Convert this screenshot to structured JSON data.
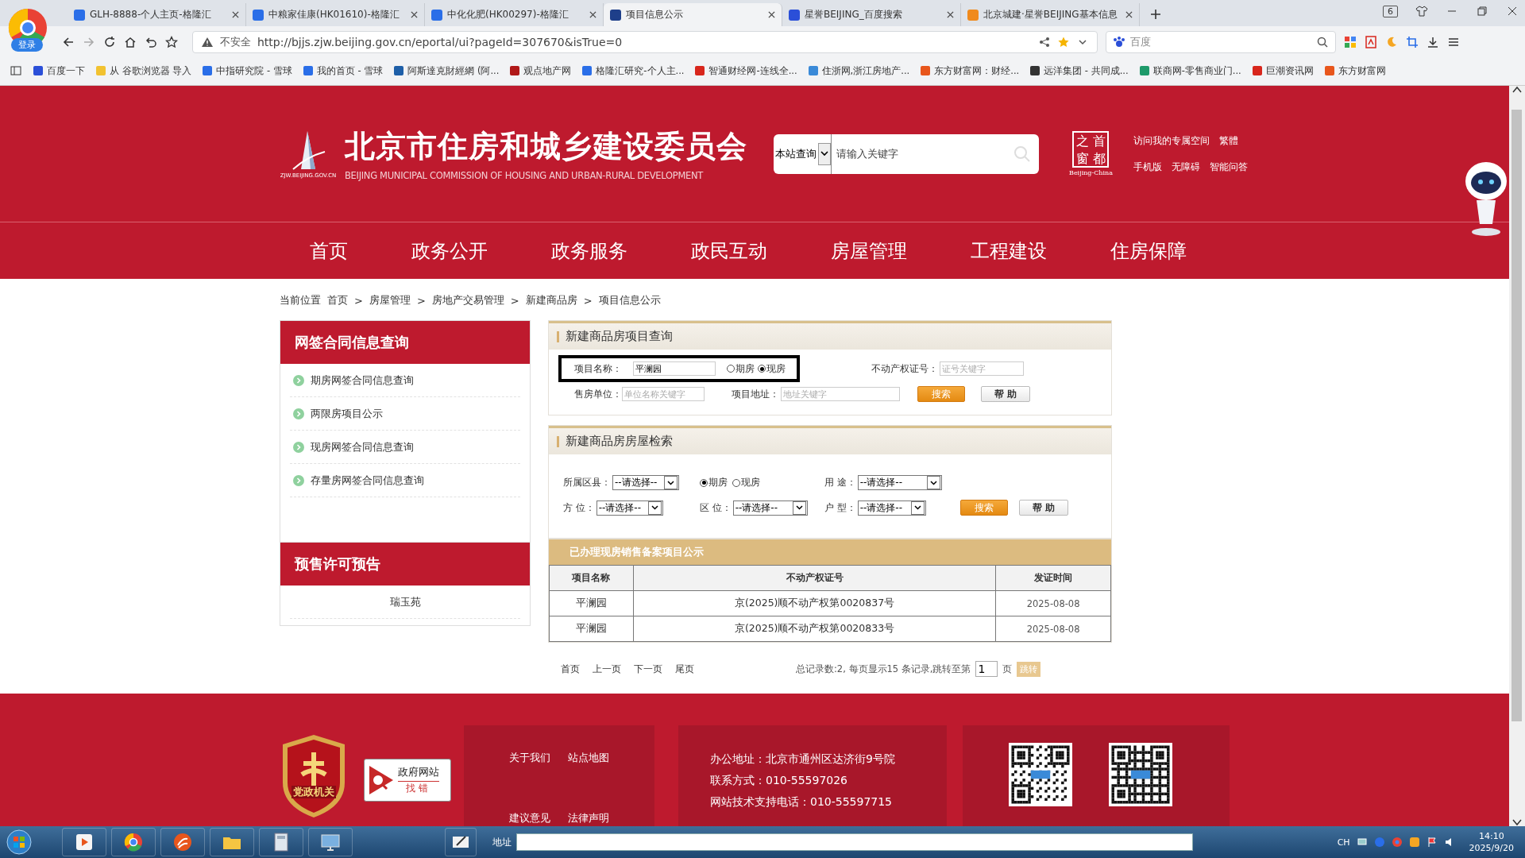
{
  "browser": {
    "login": "登录",
    "tabs": [
      {
        "title": "GLH-8888-个人主页-格隆汇",
        "selected": false,
        "color": "#2a6ee8"
      },
      {
        "title": "中粮家佳康(HK01610)-格隆汇",
        "selected": false,
        "color": "#2a6ee8"
      },
      {
        "title": "中化化肥(HK00297)-格隆汇",
        "selected": false,
        "color": "#2a6ee8"
      },
      {
        "title": "项目信息公示",
        "selected": true,
        "color": "#1e3f8a"
      },
      {
        "title": "星誉BEIJING_百度搜索",
        "selected": false,
        "color": "#2b4fd8"
      },
      {
        "title": "北京城建·星誉BEIJING基本信息",
        "selected": false,
        "color": "#f08a1c"
      }
    ],
    "tab_count": "6",
    "address": {
      "security": "不安全",
      "url": "http://bjjs.zjw.beijing.gov.cn/eportal/ui?pageId=307670&isTrue=0"
    },
    "search": {
      "placeholder": "百度"
    },
    "bookmarks": [
      {
        "label": "百度一下",
        "color": "#2b4fd8"
      },
      {
        "label": "从 谷歌浏览器 导入",
        "color": "#f2c230"
      },
      {
        "label": "中指研究院 - 雪球",
        "color": "#2a6ee8"
      },
      {
        "label": "我的首页 - 雪球",
        "color": "#2a6ee8"
      },
      {
        "label": "阿斯達克財經網 (阿...",
        "color": "#1e5fa8"
      },
      {
        "label": "观点地产网",
        "color": "#b01818"
      },
      {
        "label": "格隆汇研究-个人主...",
        "color": "#2a6ee8"
      },
      {
        "label": "智通财经网-连线全...",
        "color": "#d8261c"
      },
      {
        "label": "住浙网,浙江房地产...",
        "color": "#3a8ad8"
      },
      {
        "label": "东方财富网：财经...",
        "color": "#e8561c"
      },
      {
        "label": "远洋集团 - 共同成...",
        "color": "#333333"
      },
      {
        "label": "联商网-零售商业门...",
        "color": "#1e9a6a"
      },
      {
        "label": "巨潮资讯网",
        "color": "#d8261c"
      },
      {
        "label": "东方财富网",
        "color": "#e8561c"
      }
    ]
  },
  "header": {
    "title": "北京市住房和城乡建设委员会",
    "subtitle": "BEIJING MUNICIPAL COMMISSION OF HOUSING AND URBAN-RURAL DEVELOPMENT",
    "logo_caption": "ZJW.BEIJING.GOV.CN",
    "search": {
      "scope": "本站查询",
      "placeholder": "请输入关键字"
    },
    "badge": {
      "chars": [
        "之",
        "首",
        "窗",
        "都"
      ],
      "caption": "Beijing-China"
    },
    "links": [
      [
        "访问我的专属空间",
        "繁體"
      ],
      [
        "手机版",
        "无障碍",
        "智能问答"
      ]
    ]
  },
  "nav": [
    "首页",
    "政务公开",
    "政务服务",
    "政民互动",
    "房屋管理",
    "工程建设",
    "住房保障"
  ],
  "breadcrumb": {
    "label": "当前位置",
    "items": [
      "首页",
      "房屋管理",
      "房地产交易管理",
      "新建商品房",
      "项目信息公示"
    ],
    "separator": ">"
  },
  "sidebar": [
    {
      "title": "网签合同信息查询",
      "kind": "list",
      "items": [
        "期房网签合同信息查询",
        "两限房项目公示",
        "现房网签合同信息查询",
        "存量房网签合同信息查询"
      ]
    },
    {
      "title": "预售许可预告",
      "kind": "plain",
      "items": [
        "瑞玉苑"
      ]
    }
  ],
  "project_query": {
    "title": "新建商品房项目查询",
    "highlighted": true,
    "name_field": {
      "label": "项目名称：",
      "value": "平澜园"
    },
    "type_options": [
      {
        "label": "期房",
        "selected": false
      },
      {
        "label": "现房",
        "selected": true
      }
    ],
    "cert_field": {
      "label": "不动产权证号：",
      "placeholder": "证号关键字"
    },
    "seller_field": {
      "label": "售房单位：",
      "placeholder": "单位名称关键字"
    },
    "address_field": {
      "label": "项目地址：",
      "placeholder": "地址关键字"
    },
    "buttons": [
      "搜索",
      "帮 助"
    ]
  },
  "house_search": {
    "title": "新建商品房房屋检索",
    "rows": [
      [
        {
          "kind": "select",
          "label": "所属区县：",
          "value": "--请选择--"
        },
        {
          "kind": "radios",
          "options": [
            {
              "label": "期房",
              "selected": true
            },
            {
              "label": "现房",
              "selected": false
            }
          ]
        },
        {
          "kind": "select",
          "label": "用 途：",
          "value": "--请选择--"
        }
      ],
      [
        {
          "kind": "select",
          "label": "方 位：",
          "value": "--请选择--"
        },
        {
          "kind": "select",
          "label": "区 位：",
          "value": "--请选择--"
        },
        {
          "kind": "select",
          "label": "户 型：",
          "value": "--请选择--"
        }
      ]
    ],
    "buttons": [
      "搜索",
      "帮 助"
    ]
  },
  "results": {
    "title": "已办理现房销售备案项目公示",
    "columns": [
      "项目名称",
      "不动产权证号",
      "发证时间"
    ],
    "rows": [
      [
        "平澜园",
        "京(2025)顺不动产权第0020837号",
        "2025-08-08"
      ],
      [
        "平澜园",
        "京(2025)顺不动产权第0020833号",
        "2025-08-08"
      ]
    ]
  },
  "pagination": {
    "links": [
      "首页",
      "上一页",
      "下一页",
      "尾页"
    ],
    "summary": "总记录数:2, 每页显示15 条记录,跳转至第",
    "page": "1",
    "unit": "页",
    "go": "跳转"
  },
  "footer": {
    "badge": "党政机关",
    "report": [
      "政府网站",
      "找错"
    ],
    "links": [
      [
        "关于我们",
        "站点地图"
      ],
      [
        "建议意见",
        "法律声明"
      ]
    ],
    "contacts": [
      "办公地址：北京市通州区达济街9号院",
      "联系方式：010-55597026",
      "网站技术支持电话：010-55597715"
    ]
  },
  "taskbar": {
    "address_label": "地址",
    "lang": "CH",
    "time": "14:10",
    "date": "2025/9/20"
  }
}
